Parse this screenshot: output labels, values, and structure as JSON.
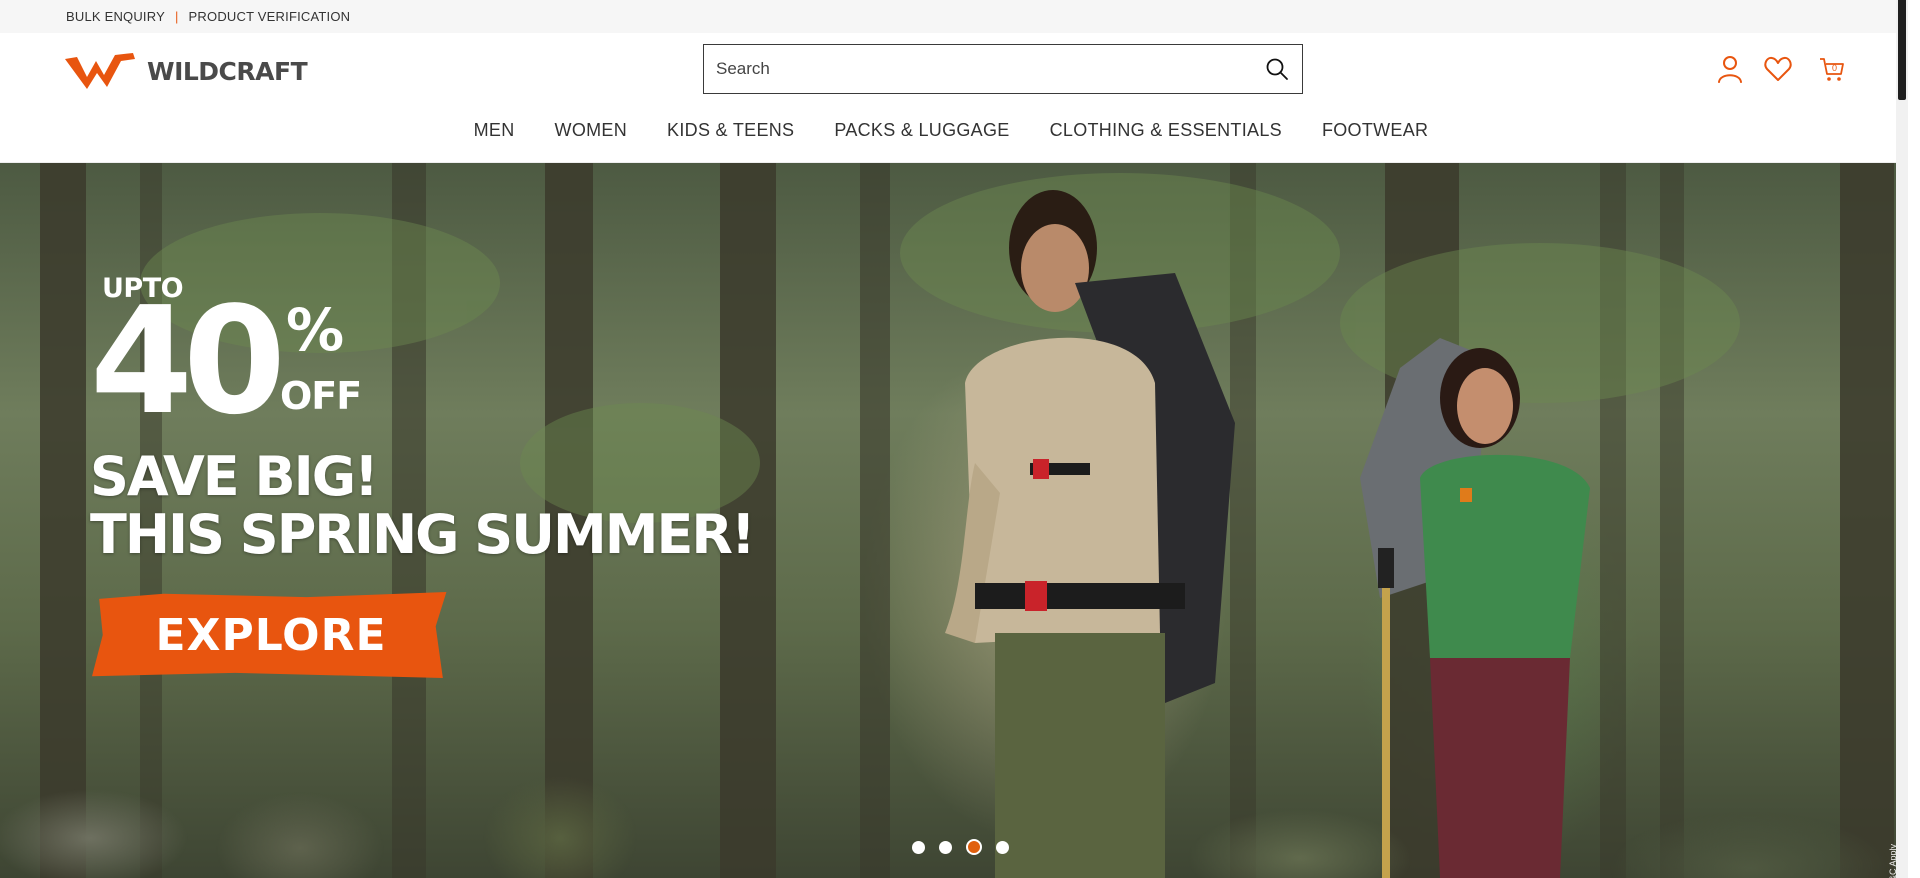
{
  "utility": {
    "bulk_enquiry": "BULK ENQUIRY",
    "separator": "|",
    "product_verification": "PRODUCT VERIFICATION"
  },
  "header": {
    "brand": "WILDCRAFT",
    "search_placeholder": "Search",
    "icons": [
      "user-icon",
      "heart-icon",
      "cart-icon"
    ],
    "cart_count": "0"
  },
  "nav": {
    "items": [
      "MEN",
      "WOMEN",
      "KIDS & TEENS",
      "PACKS & LUGGAGE",
      "CLOTHING & ESSENTIALS",
      "FOOTWEAR"
    ]
  },
  "hero": {
    "upto": "UPTO",
    "discount": "40",
    "percent": "%",
    "off": "OFF",
    "line1": "SAVE BIG!",
    "line2": "THIS SPRING SUMMER!",
    "cta": "EXPLORE",
    "terms": "*T&C Apply",
    "slides": 4,
    "active_slide": 3
  },
  "colors": {
    "accent": "#e8550f",
    "text": "#333333",
    "topbar_bg": "#f6f6f6"
  }
}
